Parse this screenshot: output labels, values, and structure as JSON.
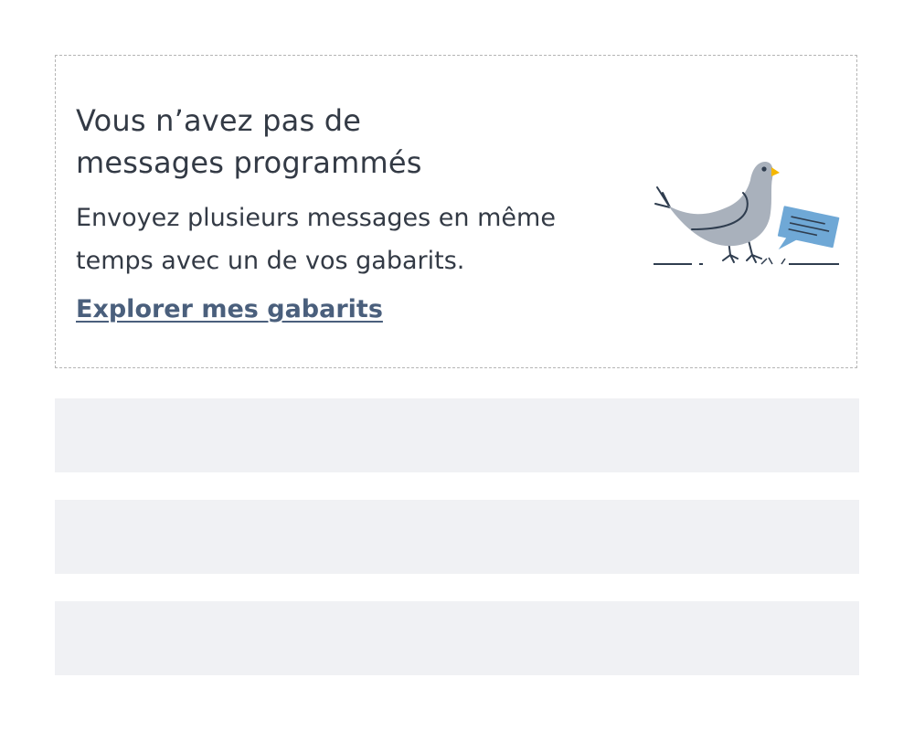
{
  "empty_state": {
    "title_line1": "Vous n’avez pas de",
    "title_line2": "messages programmés",
    "description_line1": "Envoyez plusieurs messages en même",
    "description_line2": "temps avec un de vos gabarits.",
    "link_label": "Explorer mes gabarits",
    "illustration": "pigeon-with-speech-bubble-icon"
  },
  "colors": {
    "text": "#333a45",
    "link": "#4a5f7c",
    "placeholder": "#f0f1f4",
    "border": "#b5b5b5",
    "pigeon_body": "#a9b1bc",
    "beak": "#f5b700",
    "bubble": "#6fa8d6"
  }
}
